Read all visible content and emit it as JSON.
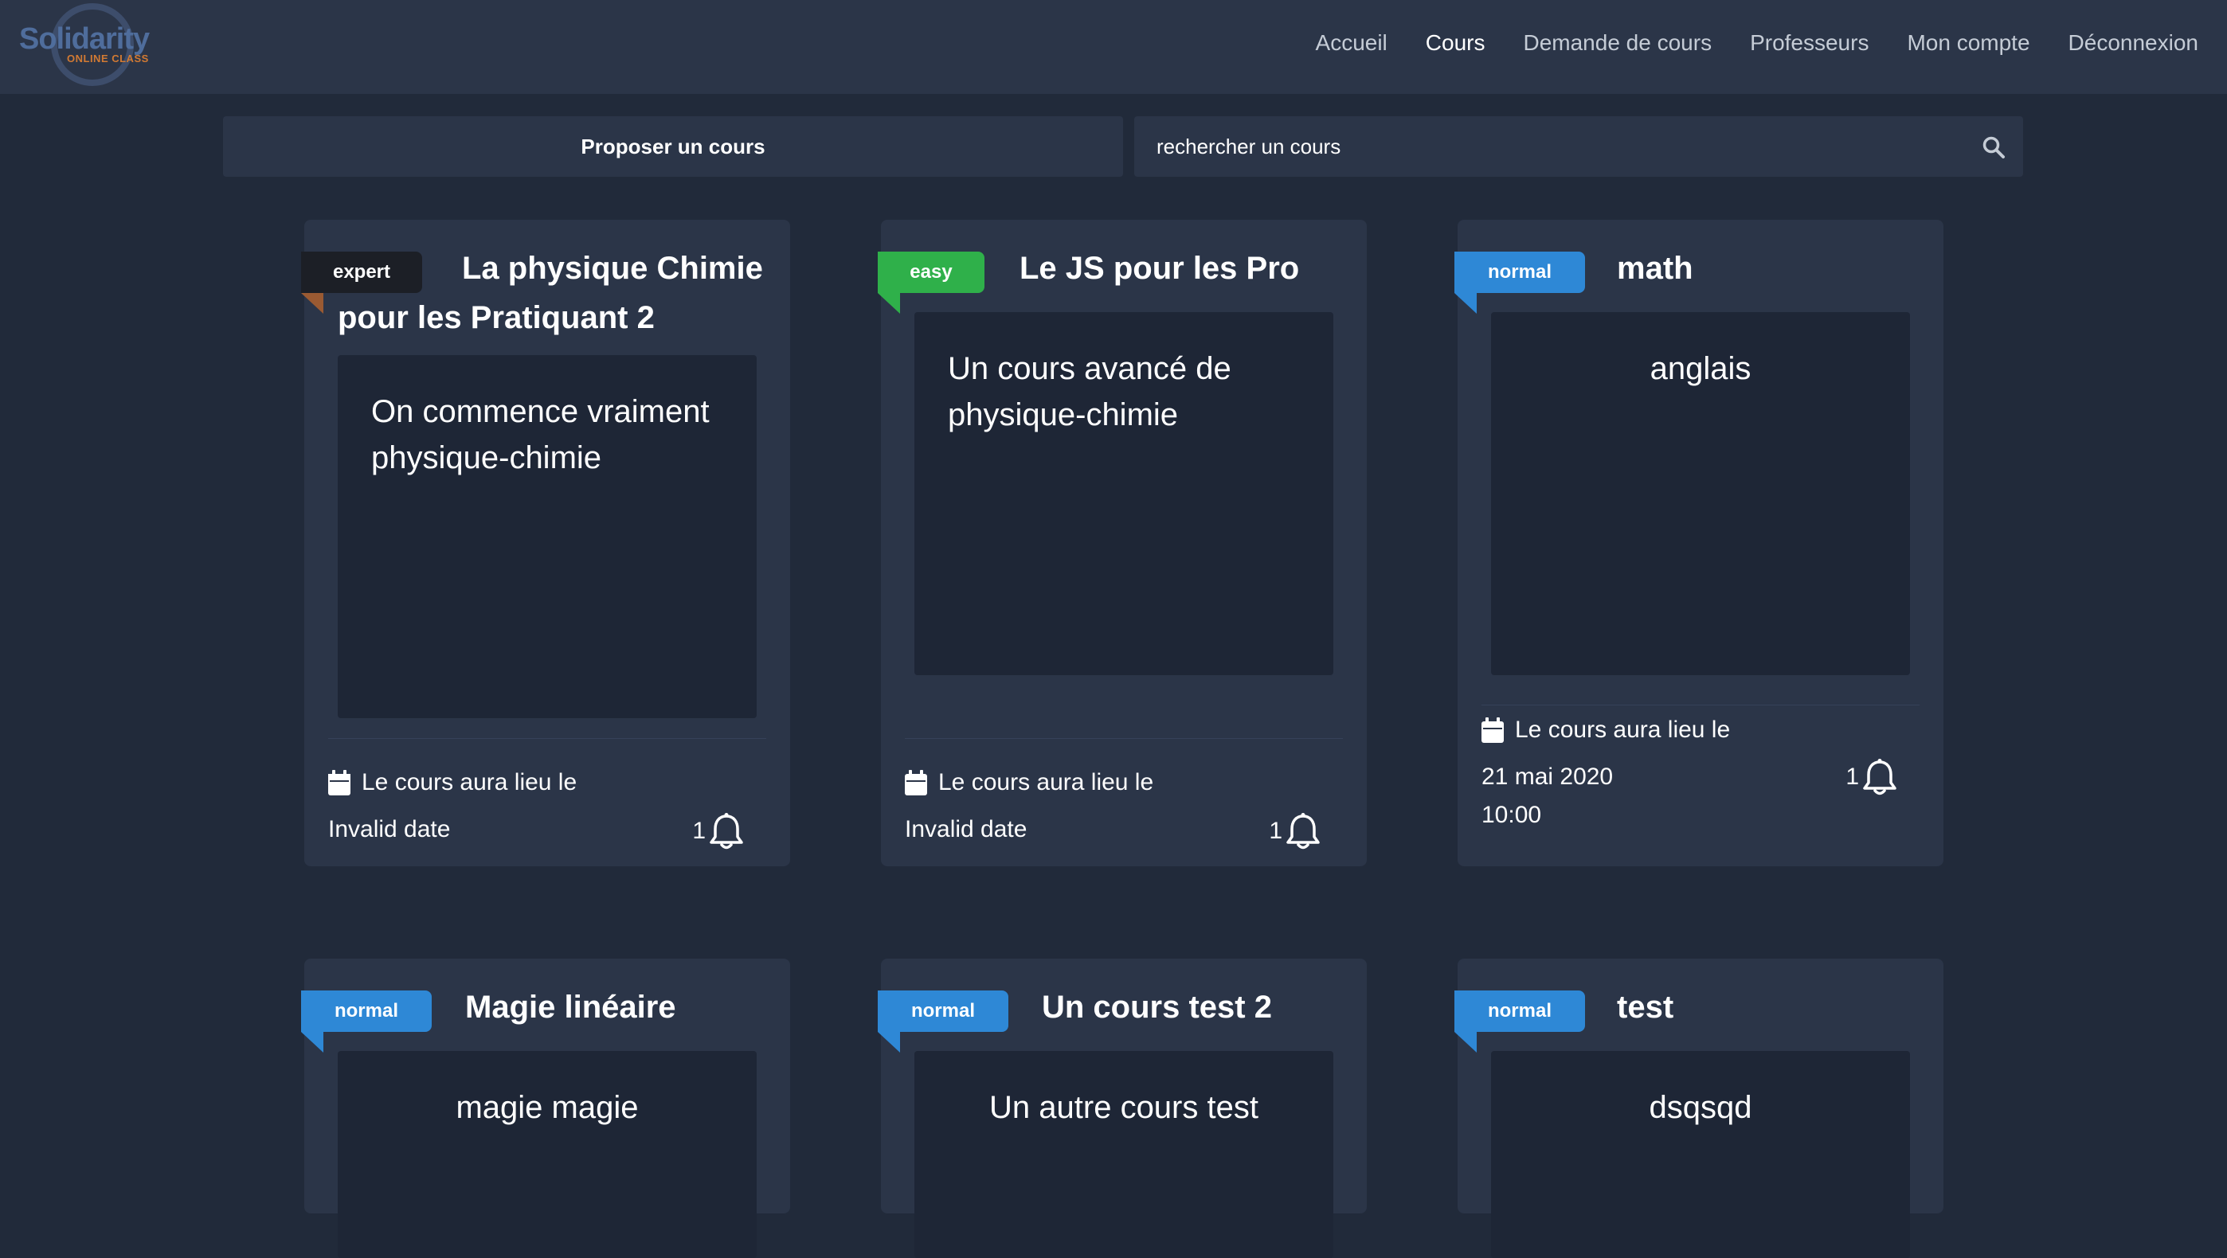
{
  "brand": {
    "name": "Solidarity",
    "tagline": "ONLINE CLASS"
  },
  "nav": {
    "items": [
      {
        "label": "Accueil",
        "active": false
      },
      {
        "label": "Cours",
        "active": true
      },
      {
        "label": "Demande de cours",
        "active": false
      },
      {
        "label": "Professeurs",
        "active": false
      },
      {
        "label": "Mon compte",
        "active": false
      },
      {
        "label": "Déconnexion",
        "active": false
      }
    ]
  },
  "toolbar": {
    "propose_label": "Proposer un cours",
    "search_placeholder": "rechercher un cours",
    "search_icon": "search-icon"
  },
  "colors": {
    "background": "#212a3a",
    "panel": "#2b3548",
    "description_bg": "#1e2636",
    "badge_expert": "#1c1f26",
    "badge_expert_fold": "#9a5a32",
    "badge_easy": "#2fb04a",
    "badge_normal": "#2e88d6"
  },
  "footer_label": "Le cours aura lieu le",
  "courses": [
    {
      "level": "expert",
      "title": "La physique Chimie pour les Pratiquant 2",
      "description": "On commence vraiment physique-chimie",
      "date": "Invalid date",
      "notifications": "1"
    },
    {
      "level": "easy",
      "title": "Le JS pour les Pro",
      "description": "Un cours avancé de physique-chimie",
      "date": "Invalid date",
      "notifications": "1"
    },
    {
      "level": "normal",
      "title": "math",
      "description": "anglais",
      "date": "21 mai 2020\n10:00",
      "notifications": "1"
    },
    {
      "level": "normal",
      "title": "Magie linéaire",
      "description": "magie magie"
    },
    {
      "level": "normal",
      "title": "Un cours test 2",
      "description": "Un autre cours test"
    },
    {
      "level": "normal",
      "title": "test",
      "description": "dsqsqd"
    }
  ]
}
